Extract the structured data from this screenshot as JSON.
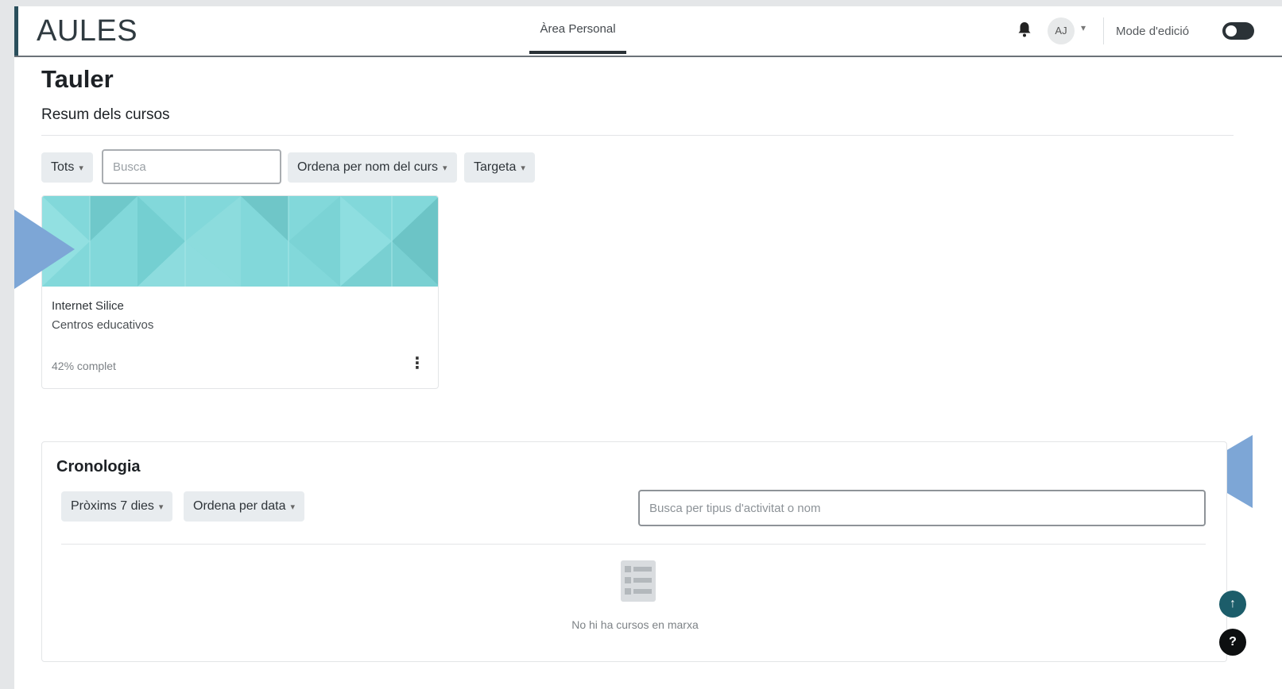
{
  "colors": {
    "accent": "#2a4f5c",
    "card_pattern": "#7fd7d9",
    "annotation_arrow": "#7da6d6",
    "fab_primary": "#1c5d6a"
  },
  "navbar": {
    "brand": "AULES",
    "tab_label": "Àrea Personal",
    "avatar_initials": "AJ",
    "edit_mode_label": "Mode d'edició",
    "icons": {
      "notifications": "bell-icon",
      "user_menu": "chevron-down-icon",
      "edit_toggle": "toggle-switch"
    }
  },
  "page": {
    "title": "Tauler",
    "section_title": "Resum dels cursos"
  },
  "course_filters": {
    "grouping": "Tots",
    "search_placeholder": "Busca",
    "sort": "Ordena per nom del curs",
    "view": "Targeta"
  },
  "courses": [
    {
      "name": "Internet Silice",
      "category": "Centros educativos",
      "progress_text": "42% complet",
      "progress_percent": 42,
      "menu_icon": "kebab-menu-icon"
    }
  ],
  "timeline": {
    "title": "Cronologia",
    "range": "Pròxims 7 dies",
    "sort": "Ordena per data",
    "search_placeholder": "Busca per tipus d'activitat o nom",
    "empty_text": "No hi ha cursos en marxa",
    "empty_icon": "empty-list-icon"
  },
  "floating": {
    "back_to_top": "↑",
    "help": "?"
  }
}
